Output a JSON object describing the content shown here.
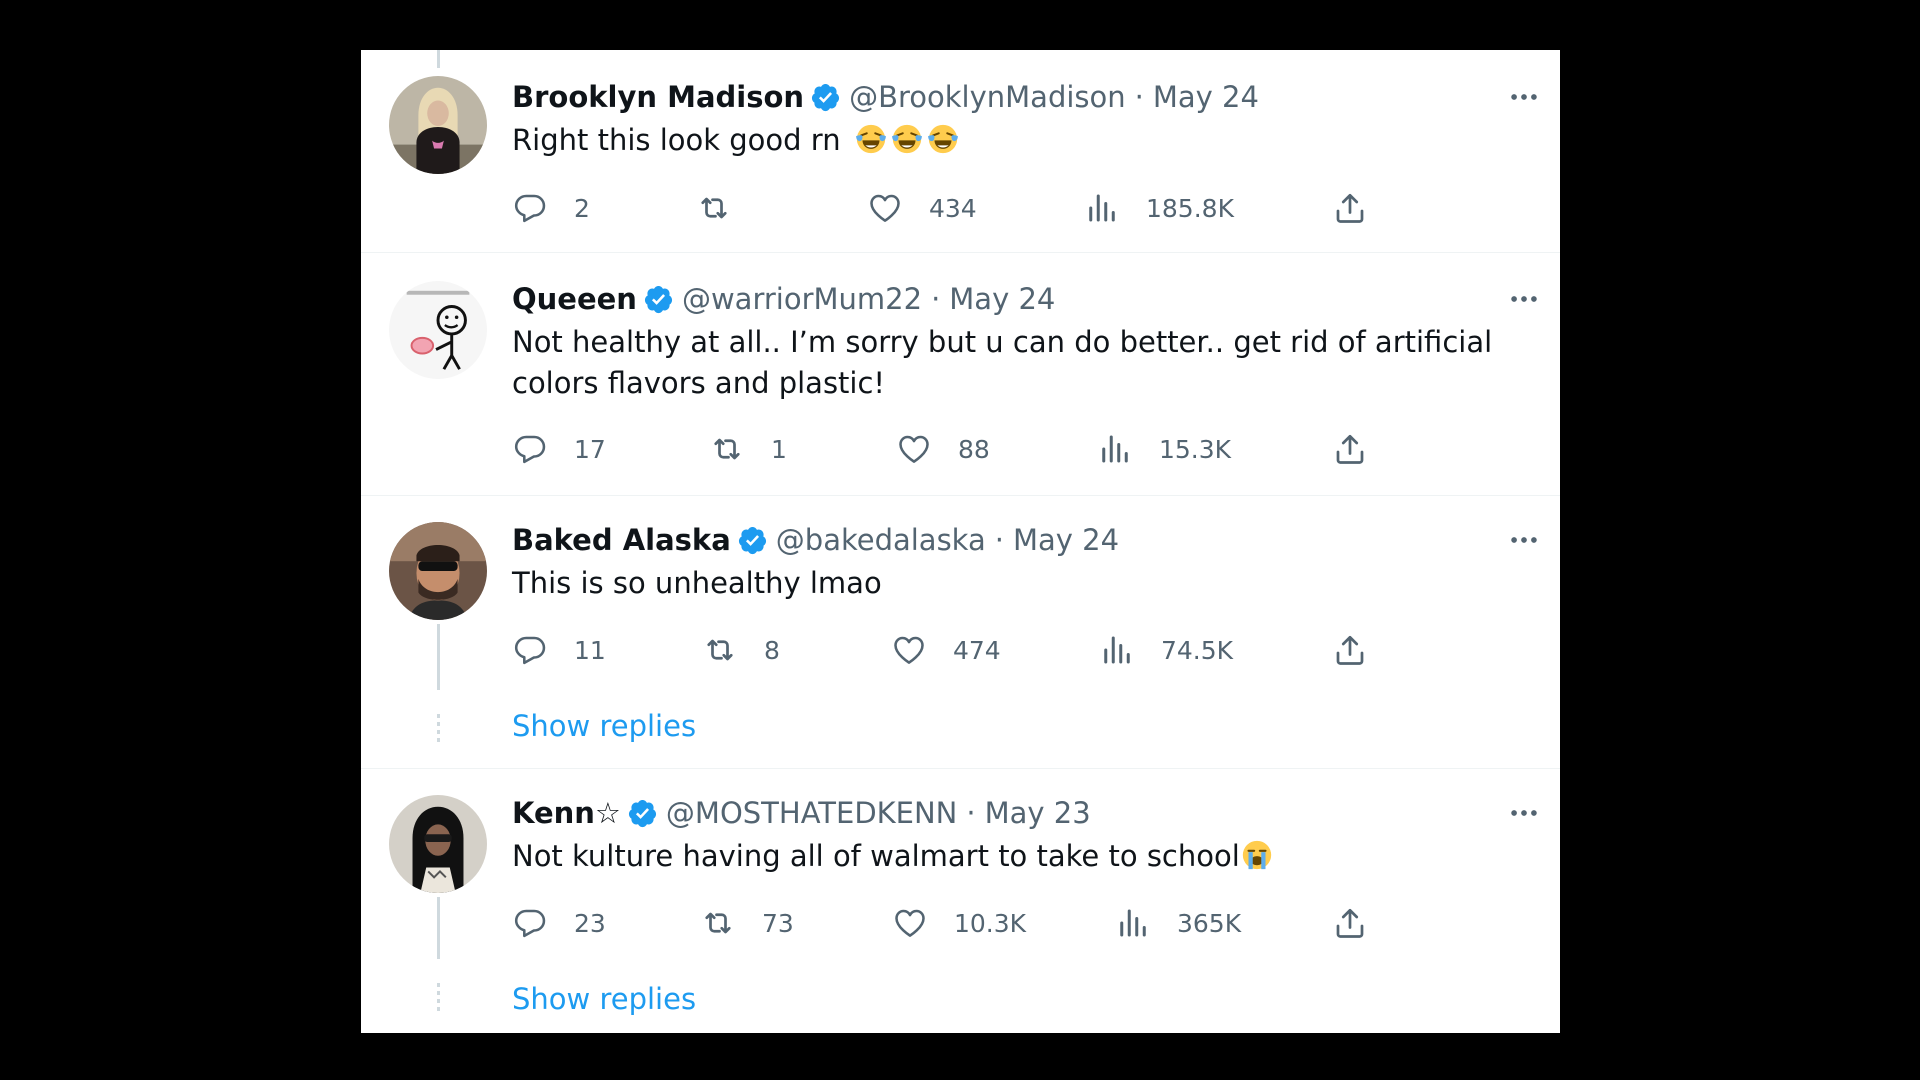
{
  "colors": {
    "accent": "#1d9bf0",
    "muted": "#536471",
    "text": "#0f1419"
  },
  "tweets": [
    {
      "name": "Brooklyn Madison",
      "handle": "@BrooklynMadison",
      "separator": "·",
      "date": "May 24",
      "text": "Right this look good rn",
      "emojis": [
        "face-with-tears-of-joy",
        "face-with-tears-of-joy",
        "face-with-tears-of-joy"
      ],
      "replies": "2",
      "retweets": "",
      "likes": "434",
      "views": "185.8K"
    },
    {
      "name": "Queeen",
      "handle": "@warriorMum22",
      "separator": "·",
      "date": "May 24",
      "text": "Not healthy at all.. I’m sorry but u can do better.. get rid of artificial colors flavors and plastic!",
      "replies": "17",
      "retweets": "1",
      "likes": "88",
      "views": "15.3K"
    },
    {
      "name": "Baked Alaska",
      "handle": "@bakedalaska",
      "separator": "·",
      "date": "May 24",
      "text": "This is so unhealthy lmao",
      "replies": "11",
      "retweets": "8",
      "likes": "474",
      "views": "74.5K",
      "show_replies": "Show replies"
    },
    {
      "name": "Kenn☆",
      "handle": "@MOSTHATEDKENN",
      "separator": "·",
      "date": "May 23",
      "text": "Not kulture having all of walmart to take to school",
      "emojis": [
        "loudly-crying-face"
      ],
      "replies": "23",
      "retweets": "73",
      "likes": "10.3K",
      "views": "365K",
      "show_replies": "Show replies"
    }
  ]
}
